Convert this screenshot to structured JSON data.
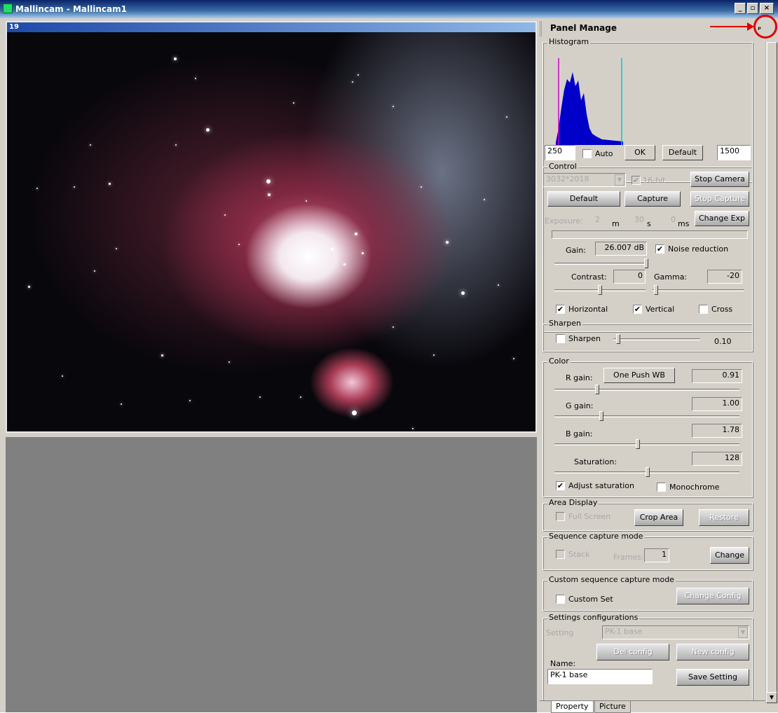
{
  "window": {
    "title": "Mallincam - Mallincam1"
  },
  "document": {
    "title": "19"
  },
  "panel": {
    "title": "Panel Manage",
    "histogram": {
      "legend": "Histogram",
      "min_value": "250",
      "auto_label": "Auto",
      "ok_label": "OK",
      "default_label": "Default",
      "max_value": "1500"
    },
    "control": {
      "legend": "Control",
      "resolution": "3032*2018",
      "bit16_label": "16-bit",
      "stop_camera": "Stop Camera",
      "default": "Default",
      "capture": "Capture",
      "stop_capture": "Stop Capture",
      "exposure_label": "Exposure:",
      "exp_min": "2",
      "exp_min_unit": "m",
      "exp_sec": "30",
      "exp_sec_unit": "s",
      "exp_ms": "0",
      "exp_ms_unit": "ms",
      "change_exp": "Change Exp",
      "gain_label": "Gain:",
      "gain_value": "26.007 dB",
      "noise_label": "Noise reduction",
      "contrast_label": "Contrast:",
      "contrast_value": "0",
      "gamma_label": "Gamma:",
      "gamma_value": "-20",
      "horizontal_label": "Horizontal",
      "vertical_label": "Vertical",
      "cross_label": "Cross"
    },
    "sharpen": {
      "legend": "Sharpen",
      "label": "Sharpen",
      "value": "0.10"
    },
    "color": {
      "legend": "Color",
      "r_label": "R gain:",
      "one_push": "One Push WB",
      "r_value": "0.91",
      "g_label": "G gain:",
      "g_value": "1.00",
      "b_label": "B gain:",
      "b_value": "1.78",
      "sat_label": "Saturation:",
      "sat_value": "128",
      "adjust_label": "Adjust saturation",
      "mono_label": "Monochrome"
    },
    "area": {
      "legend": "Area Display",
      "full_label": "Full Screen",
      "crop": "Crop Area",
      "restore": "Restore"
    },
    "sequence": {
      "legend": "Sequence capture mode",
      "stack_label": "Stack",
      "frames_label": "Frames:",
      "frames_value": "1",
      "change": "Change"
    },
    "custom": {
      "legend": "Custom sequence capture mode",
      "set_label": "Custom Set",
      "change_config": "Change Config"
    },
    "settings": {
      "legend": "Settings configurations",
      "setting_label": "Setting",
      "setting_value": "PK-1 base",
      "del": "Del config",
      "new": "New config",
      "name_label": "Name:",
      "name_value": "PK-1 base",
      "save": "Save Setting"
    },
    "pin_icon": "pin-icon"
  },
  "tabs": [
    "Property",
    "Picture"
  ],
  "colors": {
    "histogram_blue": "#0000c8",
    "histogram_magenta": "#c800c8",
    "histogram_cyan": "#00c8c8",
    "annotation_red": "#e00000"
  }
}
